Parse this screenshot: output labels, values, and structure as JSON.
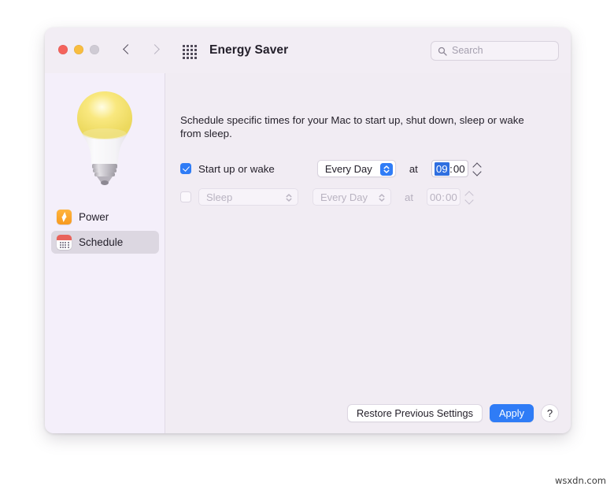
{
  "window": {
    "title": "Energy Saver",
    "traffic_lights": [
      "close",
      "minimize",
      "zoom"
    ],
    "nav": {
      "back": "back-chevron",
      "forward": "forward-chevron"
    },
    "grid_button": "show-all-preferences",
    "search": {
      "placeholder": "Search",
      "value": "",
      "icon": "search-icon"
    }
  },
  "sidebar": {
    "hero_icon": "lightbulb-icon",
    "items": [
      {
        "label": "Power",
        "icon": "power-bolt-icon",
        "selected": false
      },
      {
        "label": "Schedule",
        "icon": "calendar-icon",
        "selected": true
      }
    ]
  },
  "content": {
    "description": "Schedule specific times for your Mac to start up, shut down, sleep or wake from sleep.",
    "rows": [
      {
        "enabled": true,
        "checked": true,
        "label": "Start up or wake",
        "has_action_popup": false,
        "day_popup": "Every Day",
        "at_label": "at",
        "time": {
          "hours": "09",
          "separator": ":",
          "minutes": "00",
          "selected_part": "hours"
        }
      },
      {
        "enabled": false,
        "checked": false,
        "label": "",
        "has_action_popup": true,
        "action_popup": "Sleep",
        "day_popup": "Every Day",
        "at_label": "at",
        "time": {
          "hours": "00",
          "separator": ":",
          "minutes": "00",
          "selected_part": "none"
        }
      }
    ]
  },
  "footer": {
    "restore_label": "Restore Previous Settings",
    "apply_label": "Apply",
    "help_label": "?"
  },
  "watermark": "wsxdn.com",
  "colors": {
    "accent_blue": "#2f7cf6",
    "selection_blue": "#2f6fe0",
    "window_bg": "#f1ecf3",
    "sidebar_bg": "#f4effa",
    "power_icon": "#f79a1f",
    "calendar_icon": "#e8635c"
  }
}
